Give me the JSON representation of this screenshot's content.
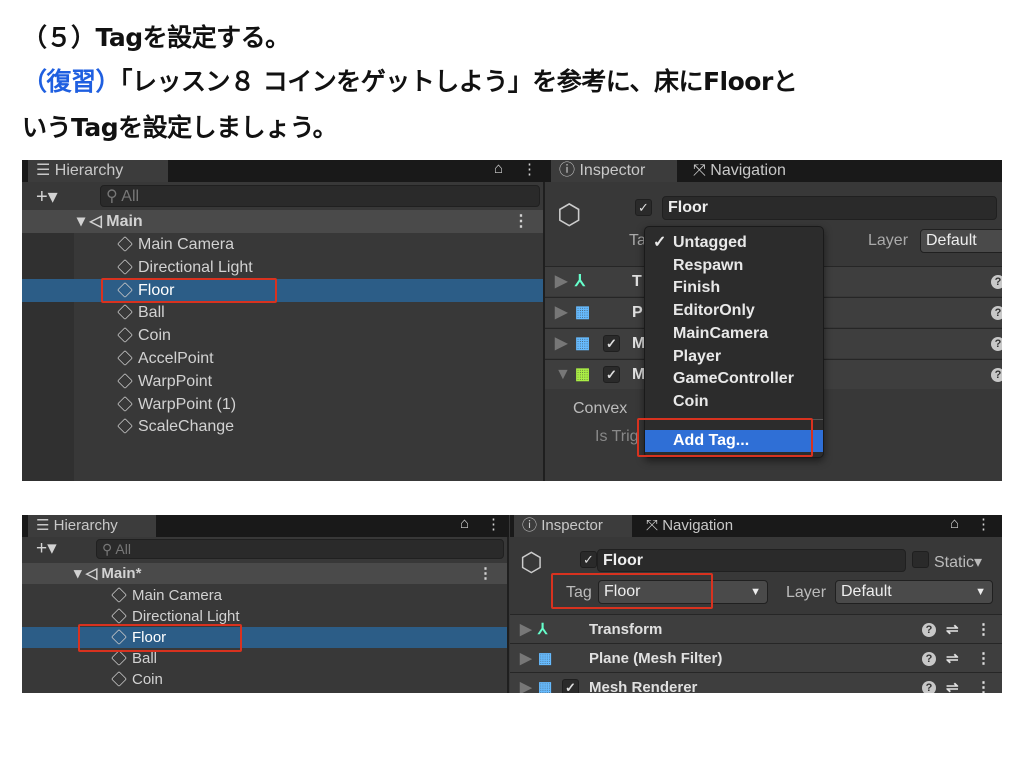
{
  "slide": {
    "line1": "（５）Tagを設定する。",
    "line2_prefix": "（復習）",
    "line2_rest": "「レッスン８ コインをゲットしよう」を参考に、床にFloorと",
    "line3": "いうTagを設定しましょう。",
    "accent_color": "#1f5fe0",
    "highlight_color": "#d8321f"
  },
  "shot1": {
    "hierarchy": {
      "tab": "Hierarchy",
      "search_placeholder": "All",
      "scene": "Main",
      "items": [
        "Main Camera",
        "Directional Light",
        "Floor",
        "Ball",
        "Coin",
        "AccelPoint",
        "WarpPoint",
        "WarpPoint (1)",
        "ScaleChange"
      ],
      "selected": "Floor"
    },
    "inspector": {
      "tab_inspector": "Inspector",
      "tab_navigation": "Navigation",
      "name": "Floor",
      "tag_label": "Tag",
      "layer_label": "Layer",
      "layer_value": "Default",
      "components": [
        "T",
        "P",
        "M",
        "M"
      ],
      "convex_label": "Convex",
      "is_trigger_label": "Is Trig"
    },
    "tag_menu": {
      "checked": "Untagged",
      "items": [
        "Untagged",
        "Respawn",
        "Finish",
        "EditorOnly",
        "MainCamera",
        "Player",
        "GameController",
        "Coin"
      ],
      "add_tag": "Add Tag..."
    }
  },
  "shot2": {
    "hierarchy": {
      "tab": "Hierarchy",
      "search_placeholder": "All",
      "scene": "Main*",
      "items": [
        "Main Camera",
        "Directional Light",
        "Floor",
        "Ball",
        "Coin"
      ],
      "selected": "Floor"
    },
    "inspector": {
      "tab_inspector": "Inspector",
      "tab_navigation": "Navigation",
      "name": "Floor",
      "static_label": "Static",
      "tag_label": "Tag",
      "tag_value": "Floor",
      "layer_label": "Layer",
      "layer_value": "Default",
      "components": [
        "Transform",
        "Plane (Mesh Filter)",
        "Mesh Renderer"
      ]
    }
  }
}
